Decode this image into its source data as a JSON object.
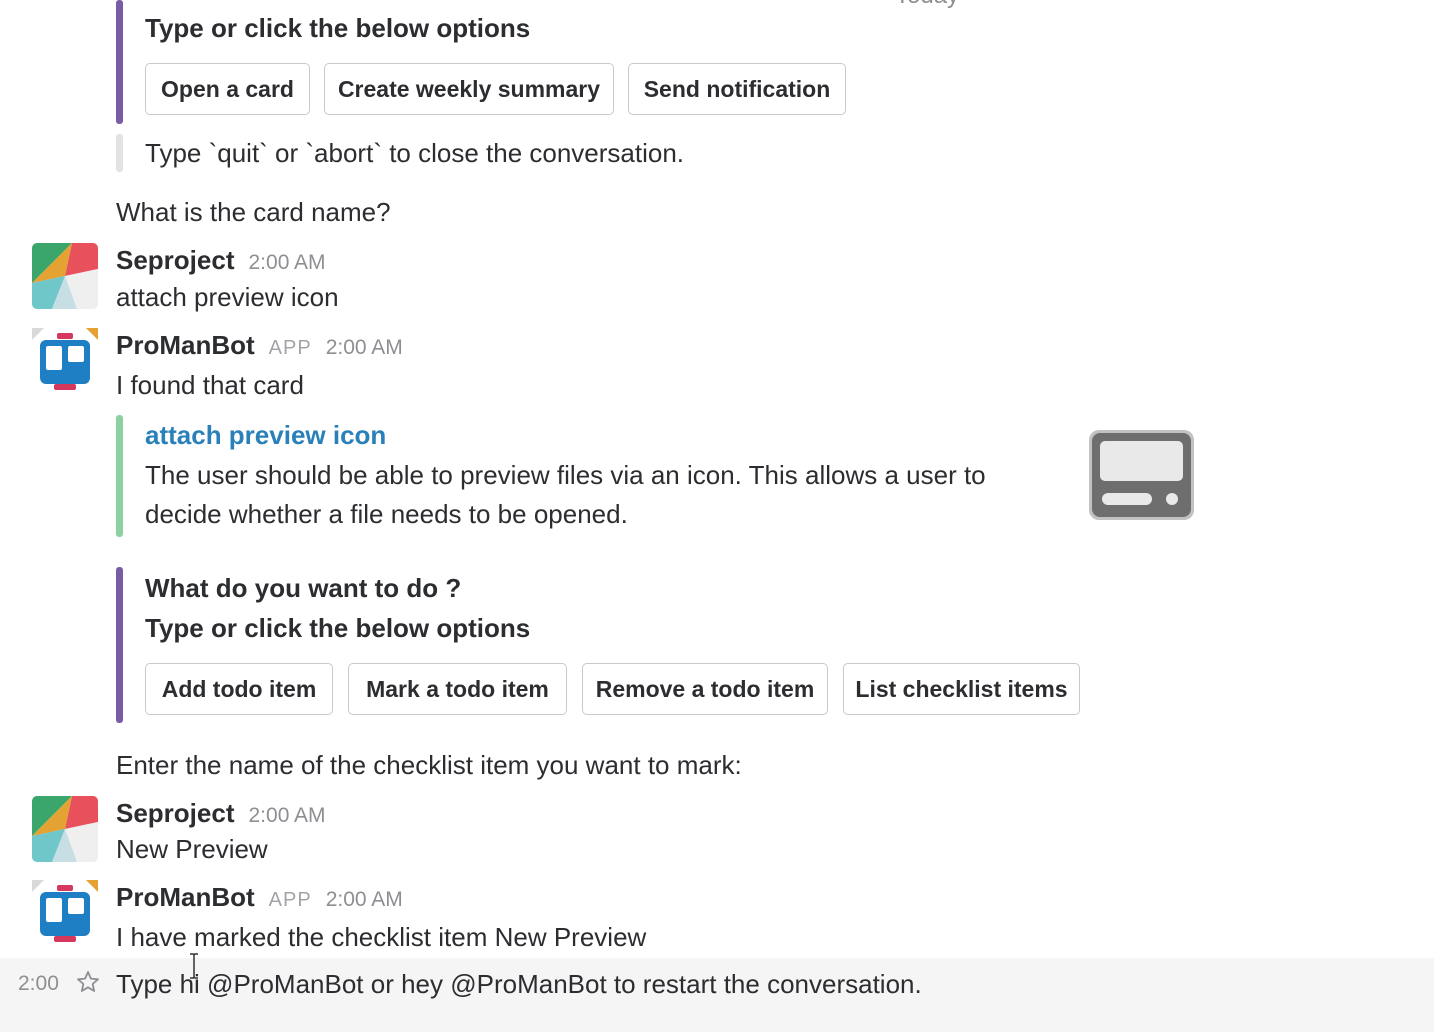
{
  "top_block": {
    "cut_text": "Today",
    "prompt": "Type or click the below options",
    "buttons": [
      "Open a card",
      "Create weekly summary",
      "Send notification"
    ],
    "quit_text": "Type `quit` or `abort` to close the conversation."
  },
  "card_question": "What is the card name?",
  "messages": [
    {
      "author": "Seproject",
      "time": "2:00 AM",
      "text": "attach preview icon"
    },
    {
      "author": "ProManBot",
      "app_tag": "APP",
      "time": "2:00 AM",
      "text": "I found that card"
    }
  ],
  "card": {
    "title": "attach preview icon",
    "desc_line1": "The user should be able to preview files via an icon. This allows a user to",
    "desc_line2": "decide whether a file needs to be opened."
  },
  "action_block": {
    "question": "What do you want to do ?",
    "prompt": "Type or click the below options",
    "buttons": [
      "Add todo item",
      "Mark a todo item",
      "Remove a todo item",
      "List checklist items"
    ]
  },
  "checklist_prompt": "Enter the name of the checklist item you want to mark:",
  "messages2": [
    {
      "author": "Seproject",
      "time": "2:00 AM",
      "text": "New Preview"
    },
    {
      "author": "ProManBot",
      "app_tag": "APP",
      "time": "2:00 AM",
      "text": "I have marked the checklist item New Preview"
    }
  ],
  "footer": {
    "time": "2:00",
    "text": "Type hi @ProManBot or hey @ProManBot to restart the conversation."
  },
  "colors": {
    "purple_bar": "#7a5ba6",
    "green_bar": "#8ed1a0",
    "grey_bar": "#e3e3e3",
    "link": "#2a80b9"
  }
}
